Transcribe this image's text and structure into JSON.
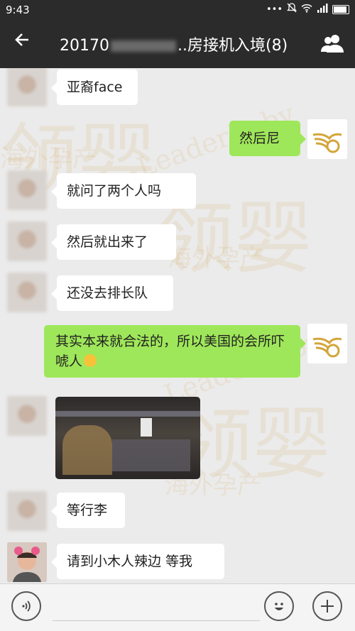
{
  "status_bar": {
    "time": "9:43",
    "icons": [
      "more-dots-icon",
      "mute-bell-icon",
      "wifi-icon",
      "signal-icon",
      "battery-icon"
    ]
  },
  "header": {
    "title_prefix": "20170",
    "title_suffix": "..房接机入境(8)",
    "back_icon": "back-arrow-icon",
    "group_icon": "group-members-icon"
  },
  "messages": [
    {
      "side": "left",
      "text": "亚裔face"
    },
    {
      "side": "right",
      "text": "然后尼"
    },
    {
      "side": "left",
      "text": "就问了两个人吗"
    },
    {
      "side": "left",
      "text": "然后就出来了"
    },
    {
      "side": "left",
      "text": "还没去排长队"
    },
    {
      "side": "right",
      "text": "其实本来就合法的，所以美国的会所吓唬人"
    },
    {
      "side": "left",
      "type": "image"
    },
    {
      "side": "left",
      "text": "等行李"
    },
    {
      "side": "left",
      "text": "请到小木人辣边 等我"
    }
  ],
  "watermark": {
    "brand_en": "LeaderBaby",
    "brand_cn": "领婴",
    "tagline": "海外孕产"
  },
  "bottom_bar": {
    "voice_icon": "voice-icon",
    "emoji_icon": "emoji-icon",
    "add_icon": "plus-icon"
  },
  "colors": {
    "header_bg": "#2b2b2b",
    "chat_bg": "#ebebeb",
    "my_bubble": "#9fe75a",
    "other_bubble": "#ffffff"
  }
}
